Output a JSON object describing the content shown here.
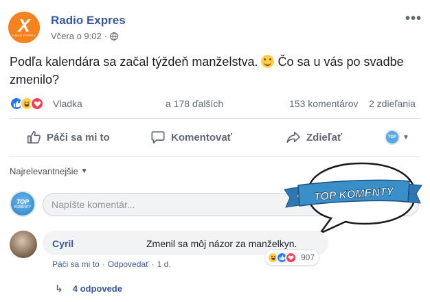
{
  "post": {
    "page_name": "Radio Expres",
    "logo_text": "X",
    "logo_sub": "RADIO EXPRES",
    "time": "Včera o 9:02",
    "dot": "·",
    "more": "•••",
    "text_before_emoji": "Podľa kalendára sa začal týždeň manželstva.",
    "text_after_emoji": "Čo sa u vás po svadbe zmenilo?",
    "emoji": "smiling-face"
  },
  "reactions": {
    "types": [
      "like",
      "haha",
      "love"
    ],
    "name": "Vladka",
    "others": "a 178 ďalších",
    "comments": "153 komentárov",
    "shares": "2 zdieľania"
  },
  "actions": {
    "like": "Páči sa mi to",
    "comment": "Komentovať",
    "share": "Zdieľať"
  },
  "sort": {
    "label": "Najrelevantnejšie"
  },
  "composer": {
    "placeholder": "Napíšte komentár...",
    "avatar_top": "TOP",
    "avatar_bottom": "KOMENTY"
  },
  "badge": {
    "label": "TOP KOMENTY"
  },
  "comment": {
    "author": "Cyril",
    "text": "Zmenil sa môj názor za manželkyn.",
    "reaction_count": "907",
    "like": "Páči sa mi to",
    "reply": "Odpovedať",
    "sep": "·",
    "age": "1 d."
  },
  "replies": {
    "label": "4 odpovede"
  },
  "colors": {
    "link": "#385898",
    "muted": "#606770",
    "brand": "#f5821f",
    "like": "#2078f4",
    "love": "#f33e58",
    "haha": "#ffcc4d",
    "badge_ribbon": "#3a8fc9"
  }
}
